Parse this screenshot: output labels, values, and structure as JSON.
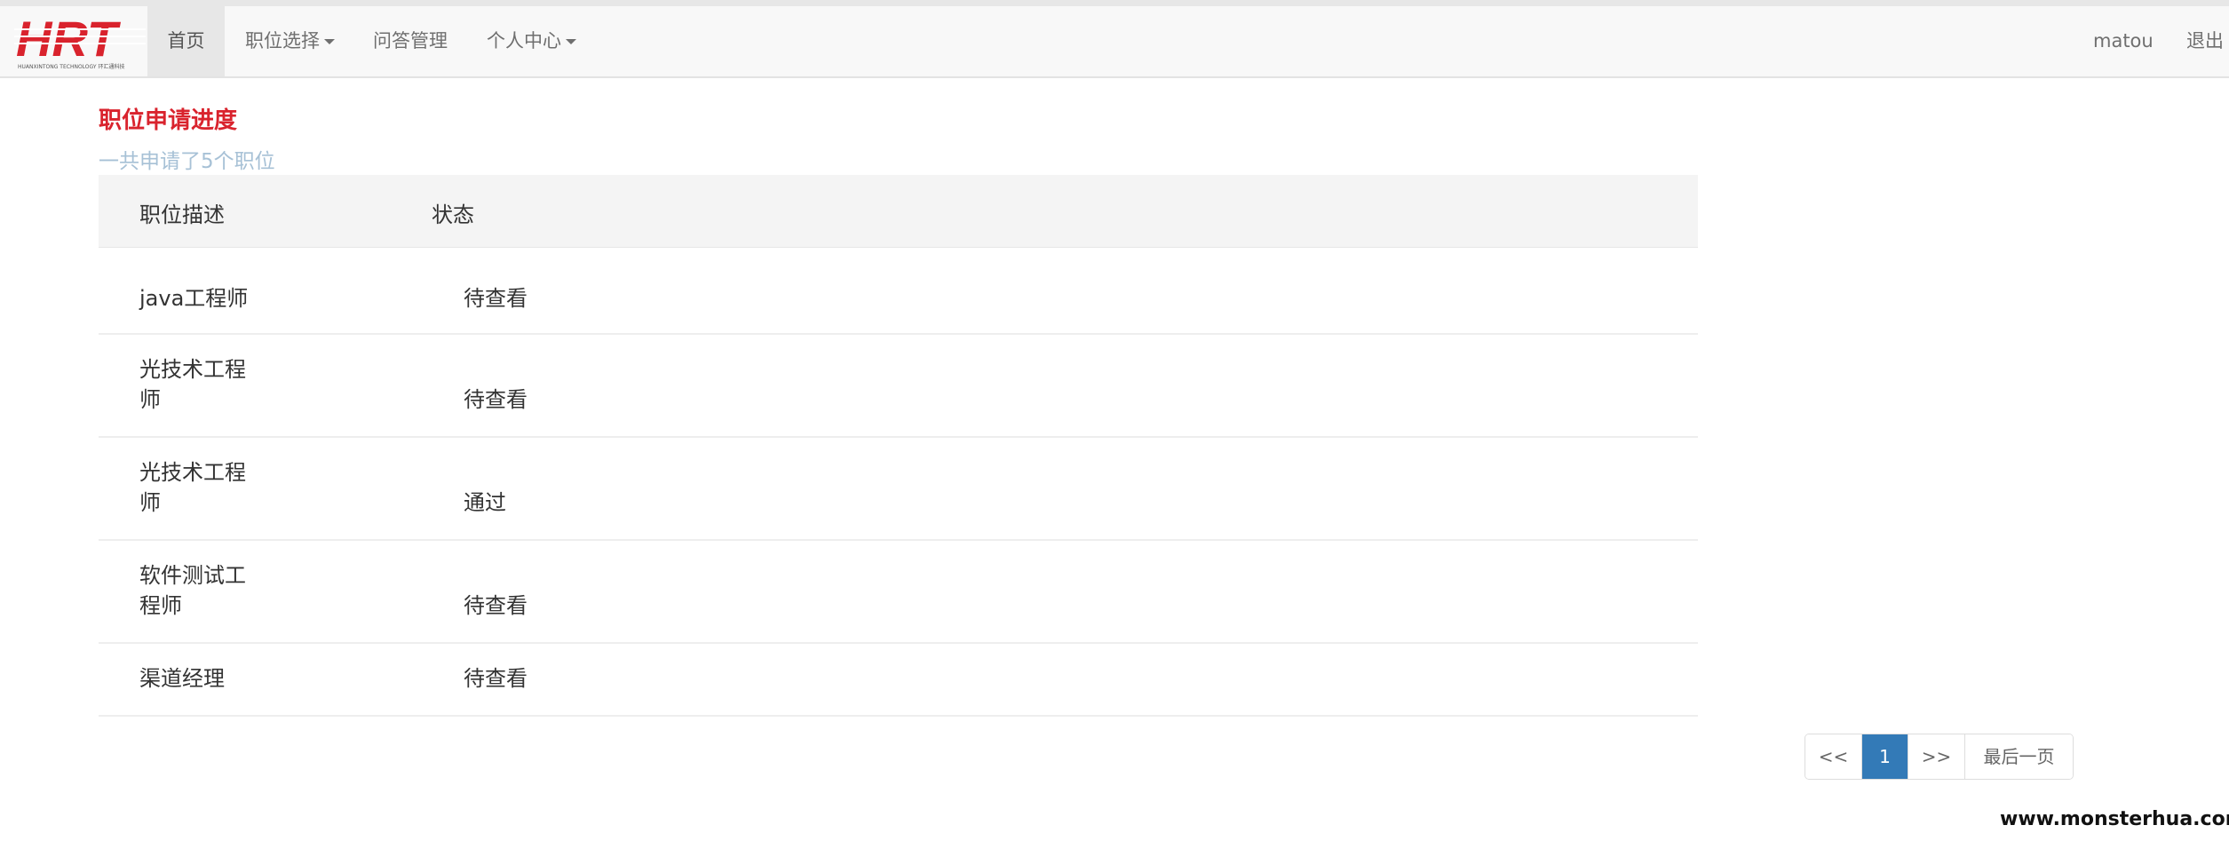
{
  "navbar": {
    "logo_text": "HRT",
    "logo_subtext": "HUANXINTONG TECHNOLOGY 环汇通科技",
    "items": [
      {
        "label": "首页",
        "active": true
      },
      {
        "label": "职位选择",
        "dropdown": true
      },
      {
        "label": "问答管理"
      },
      {
        "label": "个人中心",
        "dropdown": true
      }
    ],
    "username": "matou",
    "logout_label": "退出"
  },
  "main": {
    "title": "职位申请进度",
    "summary": "一共申请了5个职位",
    "table": {
      "headers": [
        "职位描述",
        "状态"
      ],
      "rows": [
        {
          "description": "java工程师",
          "status": "待查看"
        },
        {
          "description": "光技术工程师",
          "status": "待查看"
        },
        {
          "description": "光技术工程师",
          "status": "通过"
        },
        {
          "description": "软件测试工程师",
          "status": "待查看"
        },
        {
          "description": "渠道经理",
          "status": "待查看"
        }
      ]
    }
  },
  "pagination": {
    "prev_label": "<<",
    "current_page": "1",
    "next_label": ">>",
    "last_label": "最后一页"
  },
  "watermark": "www.monsterhua.com",
  "colors": {
    "title_red": "#d9232d",
    "subtitle_blue": "#a7c1d6",
    "pagination_active": "#337ab7",
    "navbar_bg": "#f8f8f8"
  }
}
